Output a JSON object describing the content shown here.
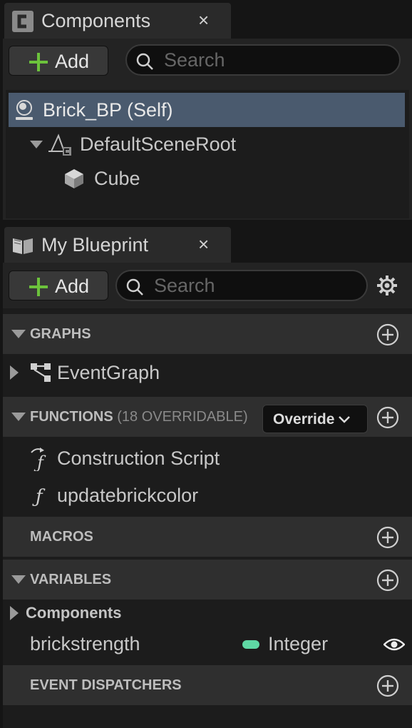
{
  "components_panel": {
    "title": "Components",
    "close": "×",
    "add_label": "Add",
    "search_placeholder": "Search",
    "tree": [
      {
        "label": "Brick_BP (Self)",
        "icon": "actor-self-icon",
        "selected": true
      },
      {
        "label": "DefaultSceneRoot",
        "icon": "scene-root-icon",
        "expanded": true
      },
      {
        "label": "Cube",
        "icon": "cube-mesh-icon"
      }
    ]
  },
  "blueprint_panel": {
    "title": "My Blueprint",
    "close": "×",
    "add_label": "Add",
    "search_placeholder": "Search",
    "sections": {
      "graphs": {
        "title": "GRAPHS",
        "items": [
          {
            "label": "EventGraph",
            "icon": "event-graph-icon"
          }
        ]
      },
      "functions": {
        "title": "FUNCTIONS",
        "subtitle": "(18 OVERRIDABLE)",
        "override_label": "Override",
        "items": [
          {
            "label": "Construction Script",
            "icon": "construction-function-icon"
          },
          {
            "label": "updatebrickcolor",
            "icon": "function-icon"
          }
        ]
      },
      "macros": {
        "title": "MACROS"
      },
      "variables": {
        "title": "VARIABLES",
        "category": "Components",
        "items": [
          {
            "name": "brickstrength",
            "type": "Integer",
            "type_color": "#5fd8a4"
          }
        ]
      },
      "event_dispatchers": {
        "title": "EVENT DISPATCHERS"
      }
    }
  },
  "colors": {
    "accent_green": "#6cc23c",
    "selection": "#4a5a6e",
    "integer_type": "#5fd8a4"
  }
}
